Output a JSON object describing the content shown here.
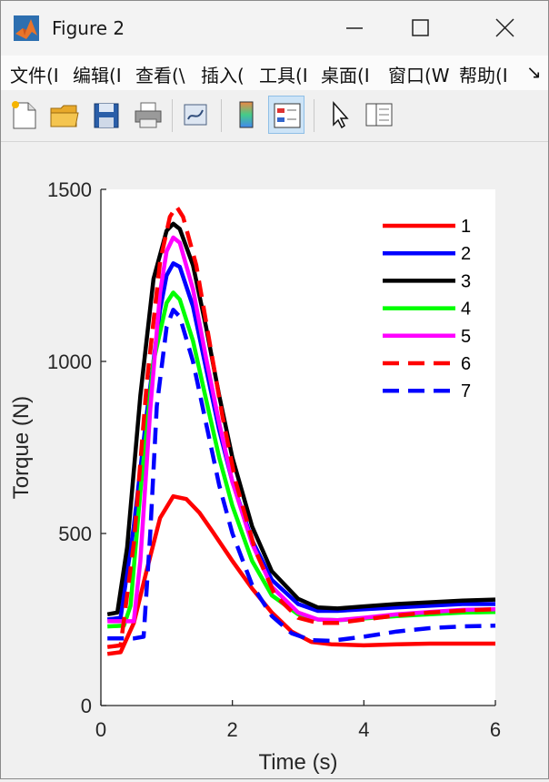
{
  "window": {
    "title": "Figure 2"
  },
  "menus": [
    "文件(I",
    "编辑(I",
    "查看(\\",
    "插入(",
    "工具(I",
    "桌面(I",
    "窗口(W",
    "帮助(I",
    "↘"
  ],
  "toolbar": {
    "buttons": [
      "new-figure",
      "open-file",
      "save",
      "print",
      "link-plot",
      "insert-colorbar",
      "insert-legend",
      "edit-plot",
      "property-inspector"
    ],
    "active": "insert-legend"
  },
  "chart_data": {
    "type": "line",
    "xlabel": "Time (s)",
    "ylabel": "Torque (N)",
    "xlim": [
      0,
      6
    ],
    "ylim": [
      0,
      1500
    ],
    "xticks": [
      "0",
      "2",
      "4",
      "6"
    ],
    "yticks": [
      "0",
      "500",
      "1000",
      "1500"
    ],
    "grid": false,
    "legend": "top-right",
    "series": [
      {
        "name": "1",
        "color": "#ff0000",
        "dash": "solid",
        "x": [
          0.1,
          0.3,
          0.5,
          0.7,
          0.9,
          1.1,
          1.3,
          1.5,
          1.7,
          2.0,
          2.3,
          2.6,
          2.9,
          3.2,
          3.5,
          4.0,
          4.5,
          5.0,
          5.5,
          6.0
        ],
        "y": [
          150,
          155,
          240,
          395,
          545,
          608,
          600,
          560,
          505,
          420,
          340,
          270,
          215,
          185,
          178,
          175,
          178,
          180,
          180,
          180
        ]
      },
      {
        "name": "2",
        "color": "#0000ff",
        "dash": "solid",
        "x": [
          0.1,
          0.3,
          0.5,
          0.7,
          0.9,
          1.0,
          1.1,
          1.2,
          1.4,
          1.6,
          1.8,
          2.0,
          2.3,
          2.6,
          3.0,
          3.3,
          3.6,
          4.0,
          4.5,
          5.0,
          5.5,
          6.0
        ],
        "y": [
          250,
          255,
          520,
          850,
          1150,
          1250,
          1285,
          1275,
          1160,
          980,
          800,
          650,
          480,
          365,
          295,
          275,
          275,
          280,
          285,
          290,
          295,
          295
        ]
      },
      {
        "name": "3",
        "color": "#000000",
        "dash": "solid",
        "x": [
          0.1,
          0.25,
          0.4,
          0.6,
          0.8,
          1.0,
          1.1,
          1.2,
          1.4,
          1.6,
          1.8,
          2.0,
          2.3,
          2.6,
          3.0,
          3.3,
          3.6,
          4.0,
          4.5,
          5.0,
          5.5,
          6.0
        ],
        "y": [
          265,
          270,
          460,
          900,
          1240,
          1380,
          1400,
          1385,
          1280,
          1100,
          900,
          720,
          520,
          390,
          310,
          285,
          282,
          288,
          295,
          300,
          305,
          308
        ]
      },
      {
        "name": "4",
        "color": "#00ff00",
        "dash": "solid",
        "x": [
          0.1,
          0.35,
          0.45,
          0.6,
          0.8,
          1.0,
          1.1,
          1.2,
          1.4,
          1.6,
          1.8,
          2.0,
          2.3,
          2.6,
          3.0,
          3.3,
          3.6,
          4.0,
          4.5,
          5.0,
          5.5,
          6.0
        ],
        "y": [
          230,
          232,
          290,
          620,
          1000,
          1170,
          1200,
          1180,
          1060,
          890,
          720,
          580,
          420,
          320,
          265,
          250,
          248,
          253,
          260,
          265,
          270,
          272
        ]
      },
      {
        "name": "5",
        "color": "#ff00ff",
        "dash": "solid",
        "x": [
          0.1,
          0.5,
          0.6,
          0.75,
          0.9,
          1.0,
          1.1,
          1.2,
          1.4,
          1.6,
          1.8,
          2.0,
          2.3,
          2.6,
          3.0,
          3.3,
          3.6,
          4.0,
          4.5,
          5.0,
          5.5,
          6.0
        ],
        "y": [
          245,
          245,
          420,
          860,
          1200,
          1320,
          1360,
          1345,
          1210,
          1010,
          820,
          650,
          470,
          345,
          270,
          250,
          248,
          255,
          265,
          272,
          278,
          280
        ]
      },
      {
        "name": "6",
        "color": "#ff0000",
        "dash": "dashed",
        "x": [
          0.1,
          0.3,
          0.5,
          0.7,
          0.9,
          1.05,
          1.15,
          1.25,
          1.45,
          1.65,
          1.85,
          2.05,
          2.35,
          2.65,
          3.0,
          3.3,
          3.6,
          4.0,
          4.5,
          5.0,
          5.5,
          6.0
        ],
        "y": [
          170,
          175,
          470,
          940,
          1290,
          1420,
          1450,
          1420,
          1280,
          1060,
          840,
          650,
          450,
          320,
          255,
          240,
          240,
          250,
          262,
          270,
          276,
          280
        ]
      },
      {
        "name": "7",
        "color": "#0000ff",
        "dash": "dashed",
        "x": [
          0.1,
          0.5,
          0.65,
          0.75,
          0.85,
          1.0,
          1.1,
          1.2,
          1.4,
          1.6,
          1.8,
          2.0,
          2.3,
          2.6,
          2.9,
          3.2,
          3.5,
          4.0,
          4.5,
          5.0,
          5.5,
          6.0
        ],
        "y": [
          195,
          195,
          200,
          500,
          870,
          1100,
          1150,
          1130,
          1000,
          820,
          640,
          500,
          350,
          260,
          210,
          190,
          188,
          200,
          215,
          225,
          230,
          232
        ]
      }
    ]
  }
}
